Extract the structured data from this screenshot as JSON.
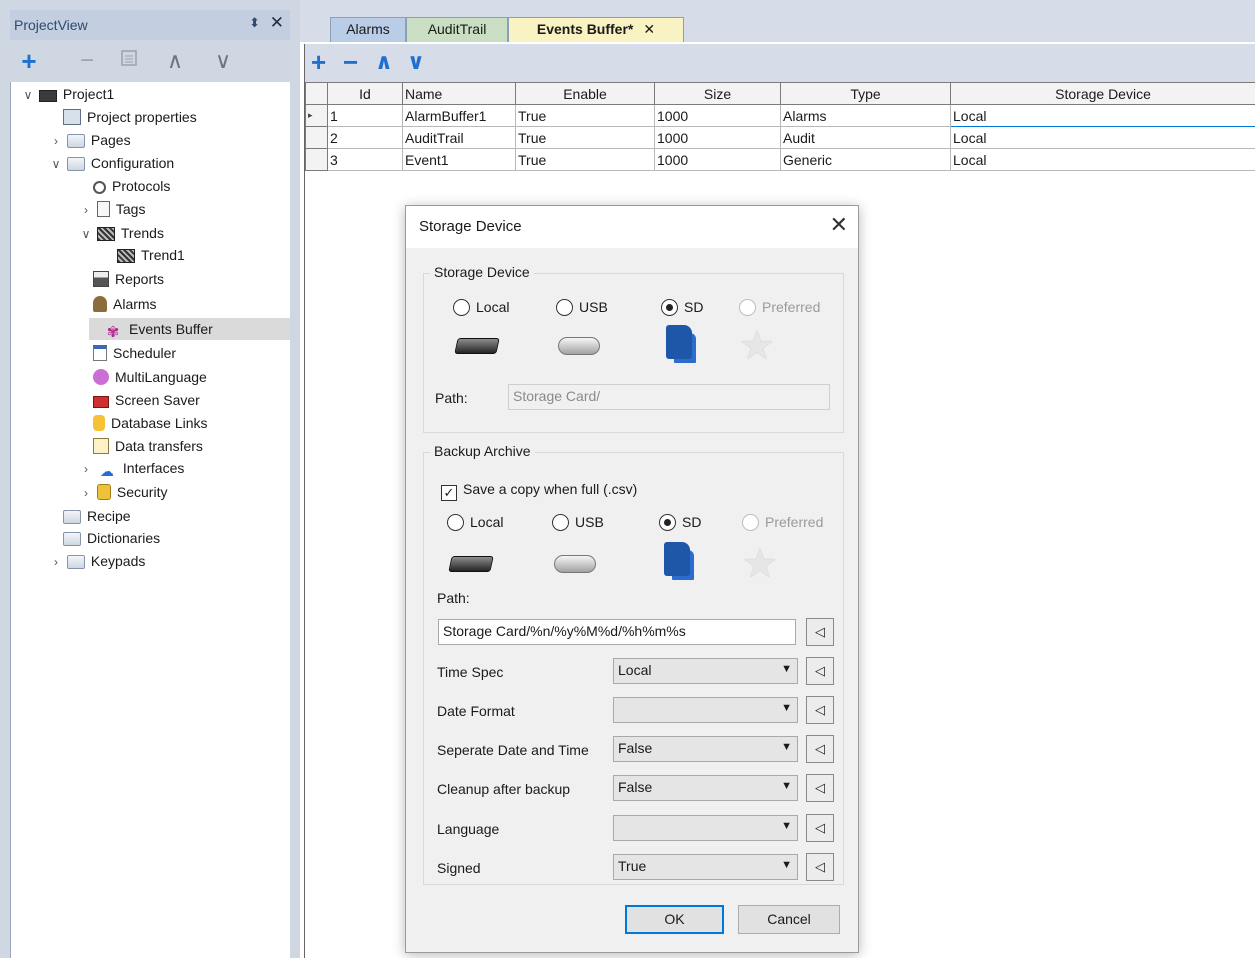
{
  "project_view": {
    "title": "ProjectView",
    "pin": "⬍",
    "close": "✕"
  },
  "toolbar_icons": {
    "add": "+",
    "remove": "−",
    "up": "∧",
    "down": "∨"
  },
  "tree": [
    {
      "label": "Project1",
      "icon": "monitor-icon"
    },
    {
      "label": "Project properties",
      "icon": "project-properties-icon"
    },
    {
      "label": "Pages",
      "icon": "folder-icon"
    },
    {
      "label": "Configuration",
      "icon": "folder-icon"
    },
    {
      "label": "Protocols",
      "icon": "protocols-icon"
    },
    {
      "label": "Tags",
      "icon": "tags-icon"
    },
    {
      "label": "Trends",
      "icon": "trends-icon"
    },
    {
      "label": "Trend1",
      "icon": "trend-icon"
    },
    {
      "label": "Reports",
      "icon": "printer-icon"
    },
    {
      "label": "Alarms",
      "icon": "bell-icon"
    },
    {
      "label": "Events Buffer",
      "icon": "events-buffer-icon"
    },
    {
      "label": "Scheduler",
      "icon": "scheduler-icon"
    },
    {
      "label": "MultiLanguage",
      "icon": "speech-bubble-icon"
    },
    {
      "label": "Screen Saver",
      "icon": "screen-saver-icon"
    },
    {
      "label": "Database Links",
      "icon": "database-icon"
    },
    {
      "label": "Data transfers",
      "icon": "data-transfer-icon"
    },
    {
      "label": "Interfaces",
      "icon": "cloud-icon"
    },
    {
      "label": "Security",
      "icon": "lock-icon"
    },
    {
      "label": "Recipe",
      "icon": "folder-icon"
    },
    {
      "label": "Dictionaries",
      "icon": "folder-icon"
    },
    {
      "label": "Keypads",
      "icon": "folder-icon"
    }
  ],
  "tabs": [
    {
      "label": "Alarms"
    },
    {
      "label": "AuditTrail"
    },
    {
      "label": "Events Buffer*",
      "close": "✕"
    }
  ],
  "grid": {
    "columns": [
      "Id",
      "Name",
      "Enable",
      "Size",
      "Type",
      "Storage Device"
    ],
    "rows": [
      {
        "marker": "▸",
        "cells": [
          "1",
          "AlarmBuffer1",
          "True",
          "1000",
          "Alarms",
          "Local"
        ]
      },
      {
        "marker": "",
        "cells": [
          "2",
          "AuditTrail",
          "True",
          "1000",
          "Audit",
          "Local"
        ]
      },
      {
        "marker": "",
        "cells": [
          "3",
          "Event1",
          "True",
          "1000",
          "Generic",
          "Local"
        ]
      }
    ]
  },
  "dialog": {
    "title": "Storage Device",
    "close": "✕",
    "storage_group": {
      "legend": "Storage Device",
      "options": [
        "Local",
        "USB",
        "SD",
        "Preferred"
      ],
      "selected": "SD",
      "path_label": "Path:",
      "path_value": "Storage Card/"
    },
    "backup_group": {
      "legend": "Backup Archive",
      "save_copy_label": "Save a copy when full (.csv)",
      "save_copy_checked": true,
      "check_mark": "✓",
      "options": [
        "Local",
        "USB",
        "SD",
        "Preferred"
      ],
      "selected": "SD",
      "path_label": "Path:",
      "path_value": "Storage Card/%n/%y%M%d/%h%m%s",
      "settings": [
        {
          "label": "Time Spec",
          "value": "Local"
        },
        {
          "label": "Date Format",
          "value": ""
        },
        {
          "label": "Seperate Date and Time",
          "value": "False"
        },
        {
          "label": "Cleanup after backup",
          "value": "False"
        },
        {
          "label": "Language",
          "value": ""
        },
        {
          "label": "Signed",
          "value": "True"
        }
      ]
    },
    "ok_label": "OK",
    "cancel_label": "Cancel"
  },
  "colors": {
    "accent": "#0078d7",
    "panel": "#cfd7e3",
    "selection": "#dadada"
  }
}
